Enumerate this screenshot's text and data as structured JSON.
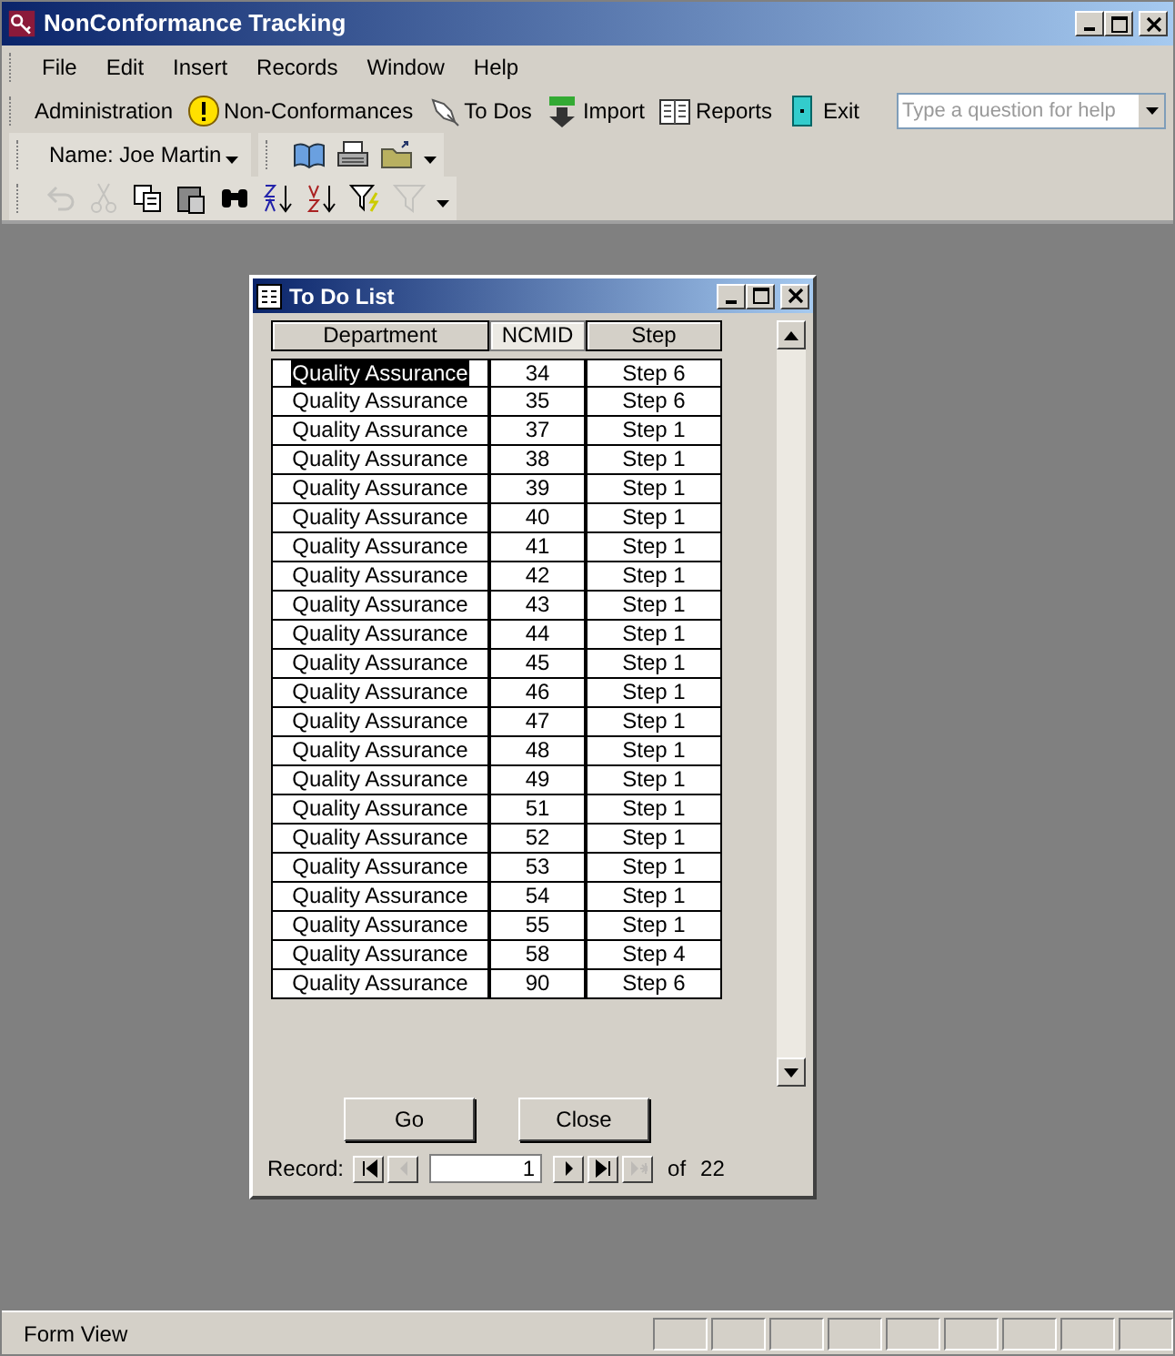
{
  "window": {
    "title": "NonConformance Tracking"
  },
  "menu": [
    "File",
    "Edit",
    "Insert",
    "Records",
    "Window",
    "Help"
  ],
  "toolbar": [
    {
      "kind": "text",
      "label": "Administration"
    },
    {
      "kind": "warning",
      "label": "Non-Conformances"
    },
    {
      "kind": "pin",
      "label": "To Dos"
    },
    {
      "kind": "import",
      "label": "Import"
    },
    {
      "kind": "book",
      "label": "Reports"
    },
    {
      "kind": "door",
      "label": "Exit"
    }
  ],
  "help_box": {
    "placeholder": "Type a question for help"
  },
  "user_box": {
    "value": "Name: Joe Martin"
  },
  "tools_1": [
    {
      "kind": "open-book",
      "disabled": false
    },
    {
      "kind": "print",
      "disabled": false
    },
    {
      "kind": "folder",
      "disabled": false
    }
  ],
  "tools_2": [
    {
      "kind": "undo",
      "disabled": true
    },
    {
      "kind": "cut",
      "disabled": true
    },
    {
      "kind": "copy",
      "disabled": false
    },
    {
      "kind": "paste",
      "disabled": false
    },
    {
      "kind": "find",
      "disabled": false
    },
    {
      "kind": "sort-asc",
      "disabled": false
    },
    {
      "kind": "sort-desc",
      "disabled": false
    },
    {
      "kind": "filter-sel",
      "disabled": false
    },
    {
      "kind": "filter",
      "disabled": true
    }
  ],
  "form": {
    "title": "To Do List",
    "columns": [
      {
        "label": "Department",
        "selected": false
      },
      {
        "label": "NCMID",
        "selected": true
      },
      {
        "label": "Step",
        "selected": false
      }
    ],
    "rows": [
      {
        "department": "Quality Assurance",
        "ncmid": "34",
        "step": "Step 6",
        "selected": true
      },
      {
        "department": "Quality Assurance",
        "ncmid": "35",
        "step": "Step 6",
        "selected": false
      },
      {
        "department": "Quality Assurance",
        "ncmid": "37",
        "step": "Step 1",
        "selected": false
      },
      {
        "department": "Quality Assurance",
        "ncmid": "38",
        "step": "Step 1",
        "selected": false
      },
      {
        "department": "Quality Assurance",
        "ncmid": "39",
        "step": "Step 1",
        "selected": false
      },
      {
        "department": "Quality Assurance",
        "ncmid": "40",
        "step": "Step 1",
        "selected": false
      },
      {
        "department": "Quality Assurance",
        "ncmid": "41",
        "step": "Step 1",
        "selected": false
      },
      {
        "department": "Quality Assurance",
        "ncmid": "42",
        "step": "Step 1",
        "selected": false
      },
      {
        "department": "Quality Assurance",
        "ncmid": "43",
        "step": "Step 1",
        "selected": false
      },
      {
        "department": "Quality Assurance",
        "ncmid": "44",
        "step": "Step 1",
        "selected": false
      },
      {
        "department": "Quality Assurance",
        "ncmid": "45",
        "step": "Step 1",
        "selected": false
      },
      {
        "department": "Quality Assurance",
        "ncmid": "46",
        "step": "Step 1",
        "selected": false
      },
      {
        "department": "Quality Assurance",
        "ncmid": "47",
        "step": "Step 1",
        "selected": false
      },
      {
        "department": "Quality Assurance",
        "ncmid": "48",
        "step": "Step 1",
        "selected": false
      },
      {
        "department": "Quality Assurance",
        "ncmid": "49",
        "step": "Step 1",
        "selected": false
      },
      {
        "department": "Quality Assurance",
        "ncmid": "51",
        "step": "Step 1",
        "selected": false
      },
      {
        "department": "Quality Assurance",
        "ncmid": "52",
        "step": "Step 1",
        "selected": false
      },
      {
        "department": "Quality Assurance",
        "ncmid": "53",
        "step": "Step 1",
        "selected": false
      },
      {
        "department": "Quality Assurance",
        "ncmid": "54",
        "step": "Step 1",
        "selected": false
      },
      {
        "department": "Quality Assurance",
        "ncmid": "55",
        "step": "Step 1",
        "selected": false
      },
      {
        "department": "Quality Assurance",
        "ncmid": "58",
        "step": "Step 4",
        "selected": false
      },
      {
        "department": "Quality Assurance",
        "ncmid": "90",
        "step": "Step 6",
        "selected": false
      }
    ],
    "buttons": [
      "Go",
      "Close"
    ],
    "navigator": {
      "label": "Record:",
      "value": "1",
      "of": "of",
      "total": "22",
      "buttons": [
        {
          "kind": "first",
          "disabled": false
        },
        {
          "kind": "prev",
          "disabled": true
        },
        {
          "kind": "next",
          "disabled": false
        },
        {
          "kind": "last",
          "disabled": false
        },
        {
          "kind": "new",
          "disabled": true
        }
      ]
    }
  },
  "status_bar": {
    "text": "Form View"
  }
}
